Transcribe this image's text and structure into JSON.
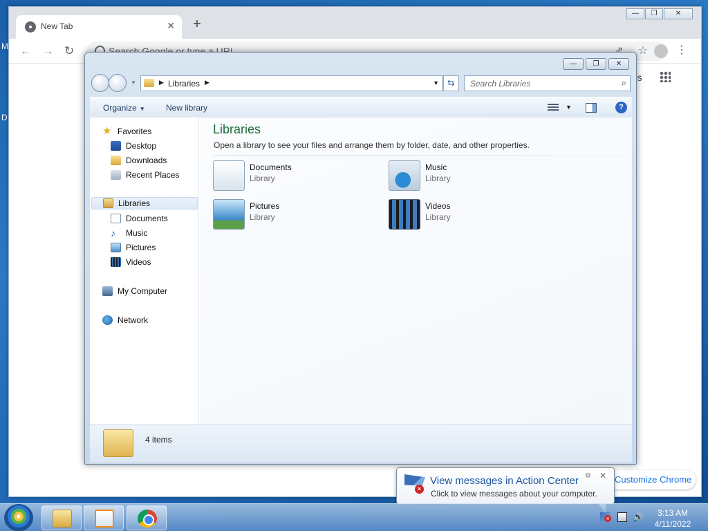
{
  "desktop": {
    "stub_1": "M",
    "stub_2": "D"
  },
  "chrome": {
    "tab_title": "New Tab",
    "tab_close": "✕",
    "new_tab": "+",
    "omnibox_placeholder": "Search Google or type a URL",
    "partial_text": "ges",
    "customize_label": "Customize Chrome",
    "nav": {
      "back": "←",
      "forward": "→",
      "reload": "↻"
    },
    "window_controls": {
      "minimize": "—",
      "maximize": "❐",
      "close": "✕"
    }
  },
  "explorer": {
    "window_controls": {
      "minimize": "—",
      "maximize": "❐",
      "close": "✕"
    },
    "address": {
      "crumb": "Libraries"
    },
    "search_placeholder": "Search Libraries",
    "commands": {
      "organize": "Organize",
      "new_library": "New library"
    },
    "nav_pane": {
      "favorites": "Favorites",
      "favorites_items": [
        "Desktop",
        "Downloads",
        "Recent Places"
      ],
      "libraries": "Libraries",
      "libraries_items": [
        "Documents",
        "Music",
        "Pictures",
        "Videos"
      ],
      "my_computer": "My Computer",
      "network": "Network"
    },
    "content": {
      "title": "Libraries",
      "subtitle": "Open a library to see your files and arrange them by folder, date, and other properties.",
      "libraries": [
        {
          "name": "Documents",
          "type": "Library",
          "icon": "documents-library-icon"
        },
        {
          "name": "Music",
          "type": "Library",
          "icon": "music-library-icon"
        },
        {
          "name": "Pictures",
          "type": "Library",
          "icon": "pictures-library-icon"
        },
        {
          "name": "Videos",
          "type": "Library",
          "icon": "videos-library-icon"
        }
      ]
    },
    "details": {
      "count": "4 items"
    }
  },
  "notification": {
    "title": "View messages in Action Center",
    "message": "Click to view messages about your computer."
  },
  "taskbar": {
    "time": "3:13 AM",
    "date": "4/11/2022",
    "pinned": [
      "windows-explorer",
      "media-player",
      "google-chrome"
    ]
  }
}
